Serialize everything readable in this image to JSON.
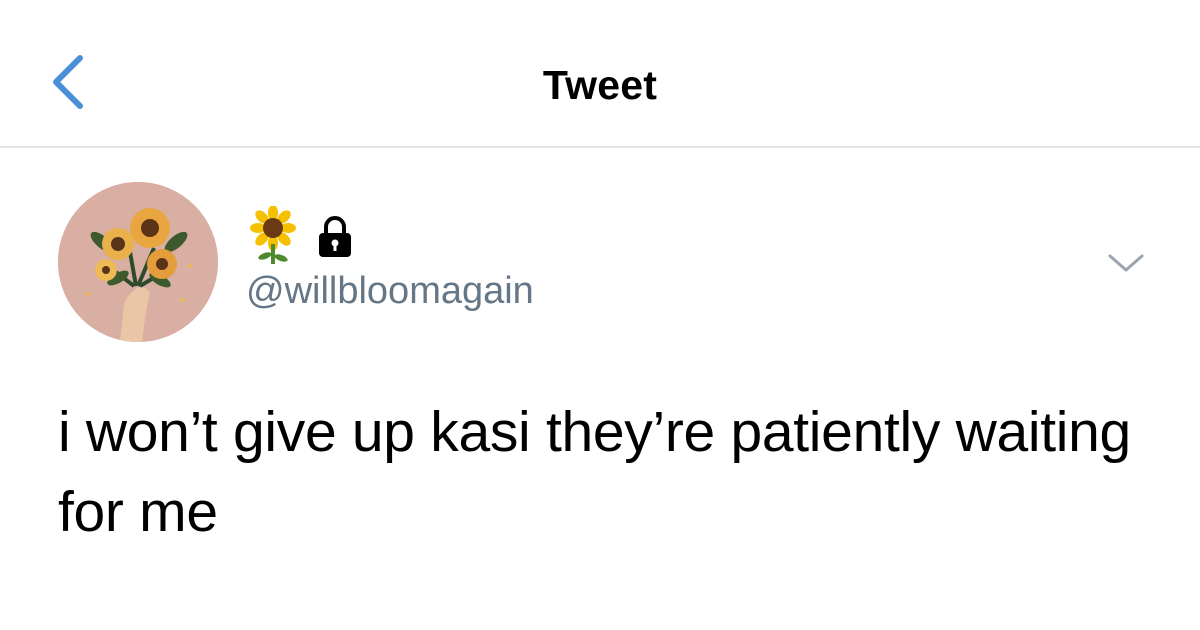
{
  "header": {
    "title": "Tweet",
    "back_icon": "chevron-left-icon"
  },
  "author": {
    "display_name_icons": [
      "sunflower-icon",
      "lock-icon"
    ],
    "handle": "@willbloomagain",
    "avatar": "sunflower-bouquet-avatar"
  },
  "tweet": {
    "text": "i won’t give up kasi they’re patiently waiting for me"
  },
  "colors": {
    "accent": "#4a90d9",
    "handle_gray": "#657786",
    "divider": "#dfe3e6",
    "avatar_bg": "#d9aea3"
  }
}
